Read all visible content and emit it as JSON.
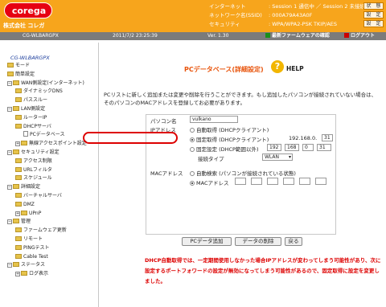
{
  "header": {
    "logo": "corega",
    "company": "株式会社 コレガ",
    "status": [
      {
        "label": "インターネット",
        "value": ": Session 1 通信中 ／ Session 2 未接続"
      },
      {
        "label": "ネットワーク名(SSID)",
        "value": ": 000A79A43A0F"
      },
      {
        "label": "セキュリティ",
        "value": ": WPA/WPA2-PSK TKIP/AES"
      }
    ],
    "buttons": [
      "状　態",
      "設　定",
      "設　定"
    ]
  },
  "subbar": {
    "model": "CG-WLBARGPX",
    "datetime": "2011/7/2 23:25:39",
    "version": "Ver. 1.30",
    "firmware_link": "最新ファームウェアの確認",
    "logout_link": "ログアウト"
  },
  "sidebar": {
    "root": "CG-WLBARGPX",
    "items": [
      {
        "label": "モード",
        "level": 1,
        "kind": "folder"
      },
      {
        "label": "簡単設定",
        "level": 1,
        "kind": "folder"
      },
      {
        "label": "WAN側設定(インターネット)",
        "level": 1,
        "kind": "folder-minus"
      },
      {
        "label": "ダイナミックDNS",
        "level": 2,
        "kind": "folder"
      },
      {
        "label": "パススルー",
        "level": 2,
        "kind": "folder"
      },
      {
        "label": "LAN側設定",
        "level": 1,
        "kind": "folder-minus"
      },
      {
        "label": "ルーターIP",
        "level": 2,
        "kind": "folder"
      },
      {
        "label": "DHCPサーバ",
        "level": 2,
        "kind": "folder"
      },
      {
        "label": "PCデータベース",
        "level": 3,
        "kind": "doc"
      },
      {
        "label": "無線アクセスポイント設定",
        "level": 2,
        "kind": "folder-plus"
      },
      {
        "label": "セキュリティ設定",
        "level": 1,
        "kind": "folder-minus"
      },
      {
        "label": "アクセス制限",
        "level": 2,
        "kind": "folder"
      },
      {
        "label": "URLフィルタ",
        "level": 2,
        "kind": "folder"
      },
      {
        "label": "スケジュール",
        "level": 2,
        "kind": "folder"
      },
      {
        "label": "詳細設定",
        "level": 1,
        "kind": "folder-minus"
      },
      {
        "label": "バーチャルサーバ",
        "level": 2,
        "kind": "folder"
      },
      {
        "label": "DMZ",
        "level": 2,
        "kind": "folder"
      },
      {
        "label": "UPnP",
        "level": 2,
        "kind": "folder-plus"
      },
      {
        "label": "管理",
        "level": 1,
        "kind": "folder-minus"
      },
      {
        "label": "ファームウェア更新",
        "level": 2,
        "kind": "folder"
      },
      {
        "label": "リモート",
        "level": 2,
        "kind": "folder"
      },
      {
        "label": "PINGテスト",
        "level": 2,
        "kind": "folder"
      },
      {
        "label": "Cable Test",
        "level": 2,
        "kind": "folder"
      },
      {
        "label": "ステータス",
        "level": 1,
        "kind": "folder-minus"
      },
      {
        "label": "ログ表示",
        "level": 2,
        "kind": "folder-plus"
      }
    ]
  },
  "main": {
    "title": "PCデータベース(詳細設定)",
    "help": "HELP",
    "description": "PCリストに新しく追加または変更や削除を行うことができます。もし追加したパソコンが接続されていない場合は、そのパソコンのMACアドレスを登録してお必要があります。",
    "form": {
      "pc_name_label": "パソコン名",
      "pc_name_value": "vulkano",
      "ip_label": "IPアドレス",
      "ip_options": [
        "自動取得 (DHCPクライアント)",
        "固定取得 (DHCPクライアント)",
        "固定設定 (DHCP範囲以外)"
      ],
      "ip_selected": 1,
      "fixed_prefix": "192.168.0.",
      "fixed_last": "31",
      "static_ip": [
        "192",
        "168",
        "0",
        "31"
      ],
      "connection_type_label": "接続タイプ",
      "connection_type_value": "WLAN",
      "mac_label": "MACアドレス",
      "mac_options": [
        "自動検索 (パソコンが接続されている状態)",
        "MACアドレス"
      ],
      "mac_selected": 1,
      "mac_fields": [
        "",
        "",
        "",
        "",
        "",
        ""
      ]
    },
    "buttons": {
      "add": "PCデータ追加",
      "delete": "データの削除",
      "back": "戻る"
    },
    "warning": "DHCP自動取得では、一定期間使用しなかった場合IPアドレスが変わってしまう可能性があり、次に設定するポートフォワードの設定が無効になってしまう可能性があるので、固定取得に設定を変更しました。"
  },
  "colors": {
    "header_bg": "#f7a51c",
    "logo_red": "#e60012",
    "title_orange": "#e8530a",
    "warning_red": "#dd0000"
  }
}
